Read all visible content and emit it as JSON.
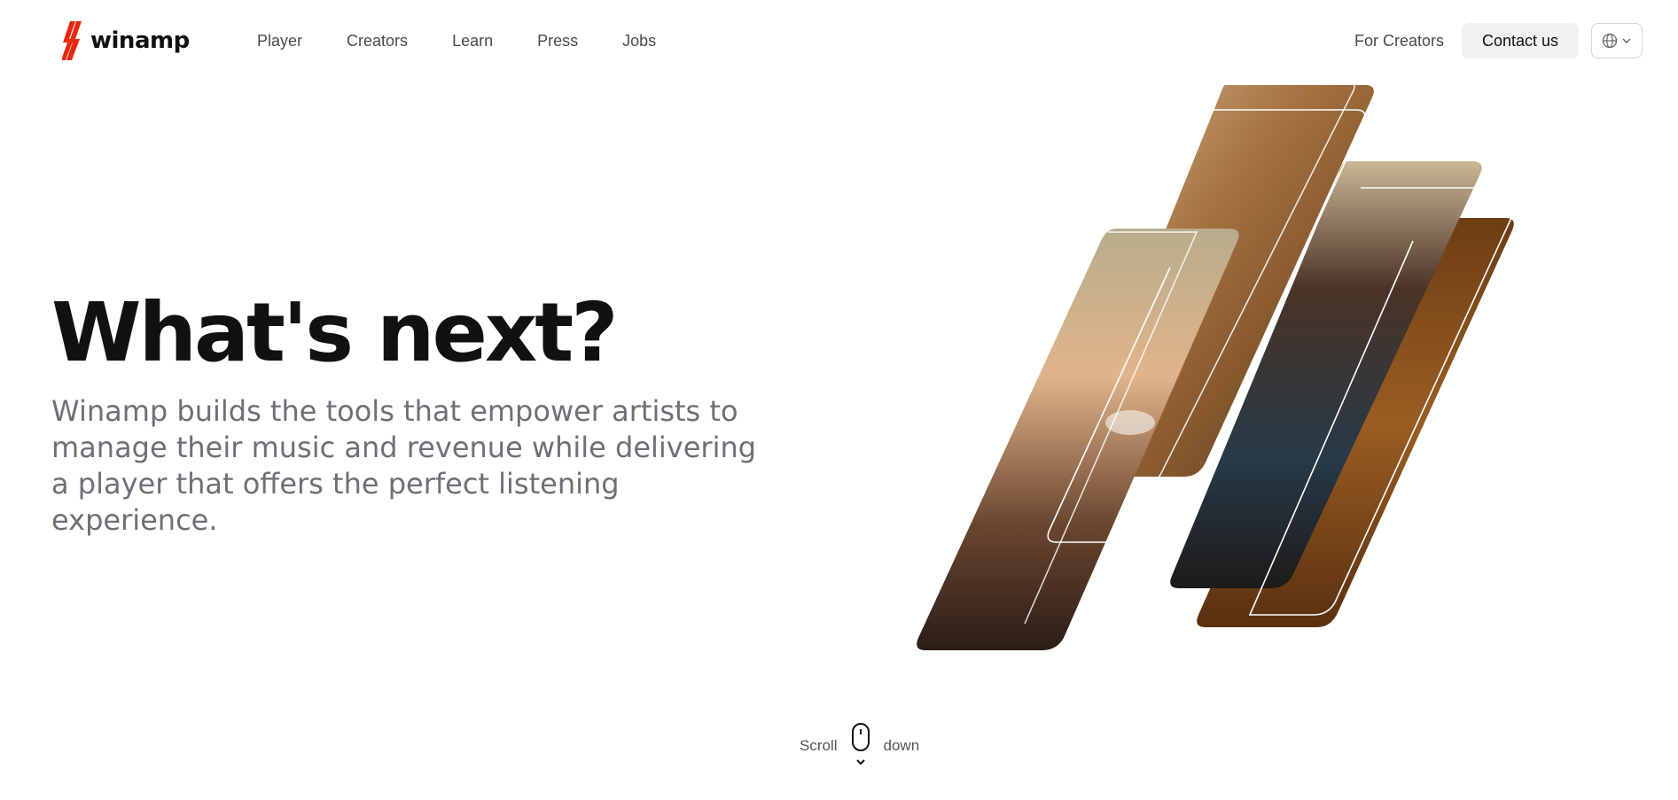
{
  "brand": {
    "name": "winamp",
    "accent_color": "#e8280f"
  },
  "nav": {
    "items": [
      {
        "label": "Player"
      },
      {
        "label": "Creators"
      },
      {
        "label": "Learn"
      },
      {
        "label": "Press"
      },
      {
        "label": "Jobs"
      }
    ]
  },
  "header_right": {
    "for_creators_label": "For Creators",
    "contact_label": "Contact us",
    "language_icon": "globe-icon",
    "dropdown_icon": "chevron-down-icon"
  },
  "hero": {
    "title": "What's next?",
    "subtitle": "Winamp builds the tools that empower artists to manage their music and revenue while delivering a player that offers the perfect listening experience."
  },
  "scroll_hint": {
    "left_text": "Scroll",
    "right_text": "down",
    "icon": "mouse-icon"
  },
  "colors": {
    "text_dark": "#111111",
    "text_muted": "#6f6f77",
    "photo_warm": "#8a5a2b"
  }
}
